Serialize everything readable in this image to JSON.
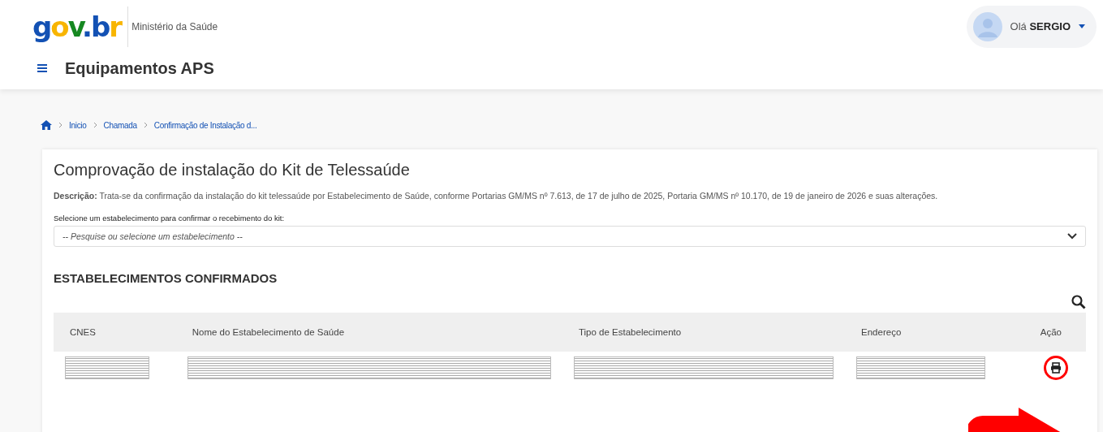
{
  "header": {
    "logo": "gov.br",
    "ministry": "Ministério da Saúde",
    "app_title": "Equipamentos APS",
    "user": {
      "greeting": "Olá",
      "name": "SERGIO"
    }
  },
  "breadcrumb": [
    "Inicio",
    "Chamada",
    "Confirmação de Instalação d..."
  ],
  "card": {
    "title": "Comprovação de instalação do Kit de Telessaúde",
    "description": "**Descrição:** Trata-se da confirmação da instalação do kit telessaúde por Estabelecimento de Saúde, conforme Portarias GM/MS nº 7.613, de 17 de julho de 2025, Portaria GM/MS nº 10.170, de 19 de janeiro de 2026 e suas alterações.",
    "select": {
      "label": "Selecione um estabelecimento para confirmar o recebimento do kit:",
      "placeholder": "-- Pesquise ou selecione um estabelecimento --"
    },
    "section_title": "ESTABELECIMENTOS CONFIRMADOS",
    "table": {
      "columns": [
        "CNES",
        "Nome do Estabelecimento de Saúde",
        "Tipo de Estabelecimento",
        "Endereço",
        "Ação"
      ],
      "rows": [
        {
          "cells": [
            {
              "kind": "redacted"
            },
            {
              "kind": "redacted"
            },
            {
              "kind": "redacted"
            },
            {
              "kind": "redacted"
            }
          ],
          "actions": [
            {
              "kind": "print",
              "highlighted": true
            }
          ]
        }
      ]
    }
  }
}
